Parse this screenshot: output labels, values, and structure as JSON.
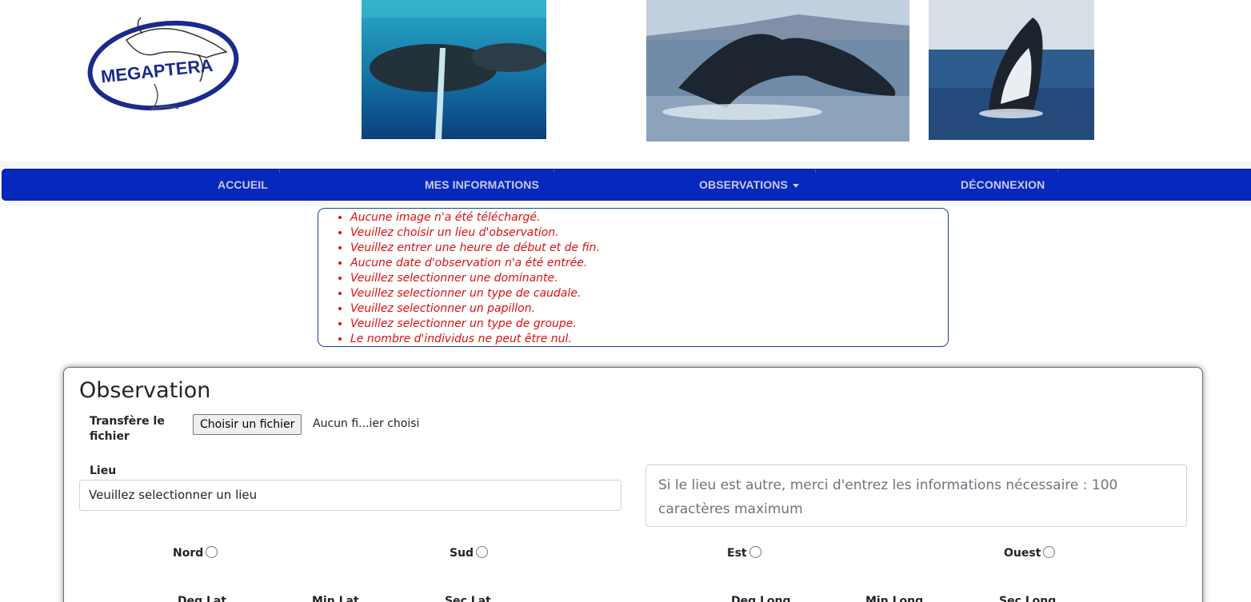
{
  "header": {
    "logo_text": "MEGAPTERA"
  },
  "nav": {
    "items": [
      {
        "label": "ACCUEIL"
      },
      {
        "label": "MES INFORMATIONS"
      },
      {
        "label": "OBSERVATIONS"
      },
      {
        "label": "DÉCONNEXION"
      }
    ],
    "bar_color": "#0628bd"
  },
  "errors": [
    "Aucune image n'a été téléchargé.",
    "Veuillez choisir un lieu d'observation.",
    "Veuillez entrer une heure de début et de fin.",
    "Aucune date d'observation n'a été entrée.",
    "Veuillez selectionner une dominante.",
    "Veuillez selectionner un type de caudale.",
    "Veuillez selectionner un papillon.",
    "Veuillez selectionner un type de groupe.",
    "Le nombre d'individus ne peut être nul."
  ],
  "form": {
    "title": "Observation",
    "file_label": "Transfère le fichier",
    "file_button": "Choisir un fichier",
    "file_status": "Aucun fi...ier choisi",
    "lieu_label": "Lieu",
    "lieu_selected": "Veuillez selectionner un lieu",
    "lieu_autre_placeholder": "Si le lieu est autre, merci d'entrez les informations nécessaire : 100 caractères maximum",
    "directions": [
      "Nord",
      "Sud",
      "Est",
      "Ouest"
    ],
    "coords": [
      "Deg Lat",
      "Min Lat",
      "Sec Lat",
      "Deg Long",
      "Min Long",
      "Sec Long"
    ]
  }
}
